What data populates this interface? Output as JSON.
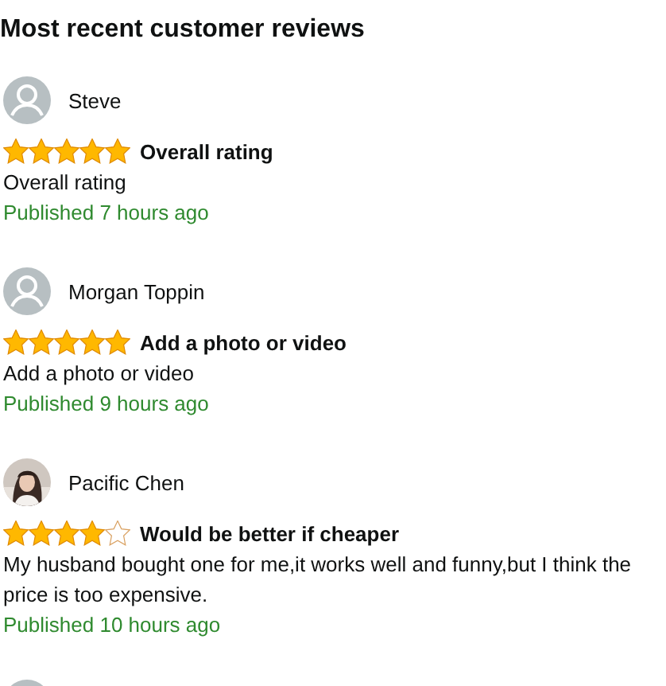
{
  "title": "Most recent customer reviews",
  "reviews": [
    {
      "avatar": {
        "kind": "default"
      },
      "name": "Steve",
      "stars": 5,
      "headline": "Overall rating",
      "body": "Overall rating",
      "published": "Published 7 hours ago"
    },
    {
      "avatar": {
        "kind": "default"
      },
      "name": "Morgan Toppin",
      "stars": 5,
      "headline": "Add a photo or video",
      "body": "Add a photo or video",
      "published": "Published 9 hours ago"
    },
    {
      "name": "Pacific Chen",
      "stars": 4,
      "headline": "Would be better if cheaper",
      "body": "My husband bought one for me,it works well and funny,but I think the price is too expensive.",
      "published": "Published 10 hours ago"
    },
    {
      "avatar": {
        "kind": "default"
      }
    }
  ]
}
